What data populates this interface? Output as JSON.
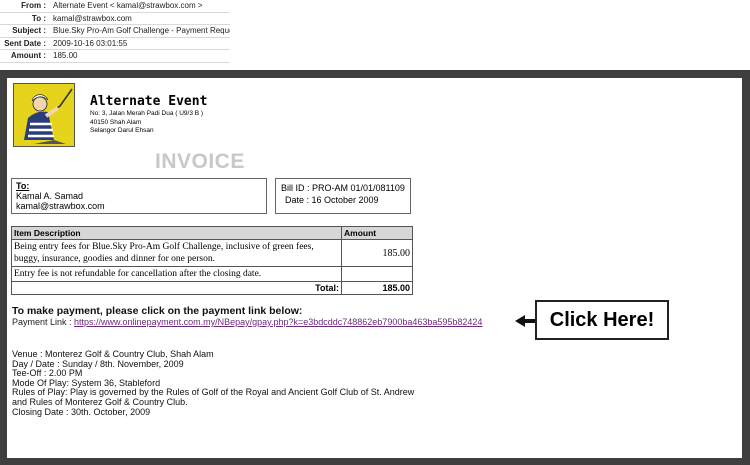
{
  "email_header": [
    {
      "label": "From :",
      "value": "Alternate Event   < kamal@strawbox.com >"
    },
    {
      "label": "To :",
      "value": "kamal@strawbox.com"
    },
    {
      "label": "Subject :",
      "value": "Blue.Sky Pro-Am Golf Challenge - Payment Request"
    },
    {
      "label": "Sent Date :",
      "value": "2009-10-16 03:01:55"
    },
    {
      "label": "Amount :",
      "value": "185.00"
    }
  ],
  "company": {
    "name": "Alternate Event",
    "address": [
      "No: 3, Jalan Merah Padi Dua ( U9/3 B )",
      "40150 Shah Alam",
      "Selangor Darul Ehsan"
    ]
  },
  "invoice_title": "INVOICE",
  "to": {
    "label": "To:",
    "name": "Kamal A. Samad",
    "email": "kamal@strawbox.com"
  },
  "bill": {
    "id": "Bill ID : PRO-AM 01/01/081109",
    "date": "Date : 16 October 2009"
  },
  "table": {
    "headers": [
      "Item Description",
      "Amount"
    ],
    "rows": [
      {
        "description": "Being entry fees for Blue.Sky Pro-Am Golf Challenge, inclusive of green fees, buggy, insurance, goodies and dinner for one person.",
        "amount": "185.00"
      },
      {
        "description": "Entry fee is not refundable for cancellation after the closing date.",
        "amount": ""
      }
    ],
    "total_label": "Total:",
    "total": "185.00"
  },
  "payment": {
    "heading": "To make payment, please click on the payment link below:",
    "link_label": "Payment Link : ",
    "url": "https://www.onlinepayment.com.my/NBepay/gpay.php?k=e3bdcddc748862eb7900ba463ba595b82424",
    "callout": "Click Here!"
  },
  "details": [
    "Venue : Monterez Golf & Country Club, Shah Alam",
    "Day / Date : Sunday / 8th. November, 2009",
    "Tee-Off : 2.00 PM",
    "Mode Of Play: System 36, Stableford",
    "Rules of Play: Play is governed by the Rules of Golf of the Royal and Ancient Golf Club of St. Andrew",
    "and Rules of Monterez Golf & Country Club.",
    "Closing Date : 30th. October, 2009"
  ],
  "icons": {
    "logo": "golfer-logo-icon",
    "arrow": "arrow-left-icon"
  }
}
